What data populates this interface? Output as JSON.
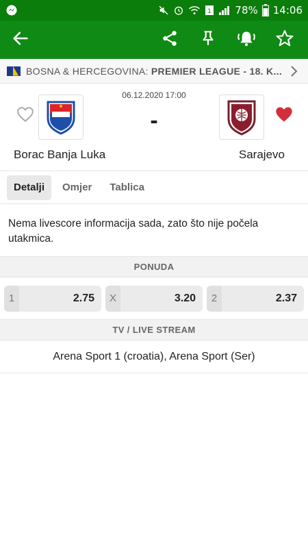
{
  "statusbar": {
    "battery": "78%",
    "time": "14:06"
  },
  "league": {
    "country": "BOSNA & HERCEGOVINA:",
    "competition": "PREMIER LEAGUE - 18. K..."
  },
  "match": {
    "datetime": "06.12.2020 17:00",
    "separator": "-",
    "home": {
      "name": "Borac Banja Luka",
      "favorite": false
    },
    "away": {
      "name": "Sarajevo",
      "favorite": true
    }
  },
  "tabs": [
    {
      "label": "Detalji",
      "active": true
    },
    {
      "label": "Omjer",
      "active": false
    },
    {
      "label": "Tablica",
      "active": false
    }
  ],
  "info": {
    "text": "Nema livescore informacija sada, zato što nije počela utakmica."
  },
  "odds_section": {
    "title": "PONUDA",
    "items": [
      {
        "label": "1",
        "value": "2.75"
      },
      {
        "label": "X",
        "value": "3.20"
      },
      {
        "label": "2",
        "value": "2.37"
      }
    ]
  },
  "tv_section": {
    "title": "TV / LIVE STREAM",
    "channels": "Arena Sport 1 (croatia), Arena Sport (Ser)"
  },
  "colors": {
    "appbar": "#0f8a14",
    "statusbar": "#0b7d0b",
    "favorite_active": "#d32f3a"
  }
}
